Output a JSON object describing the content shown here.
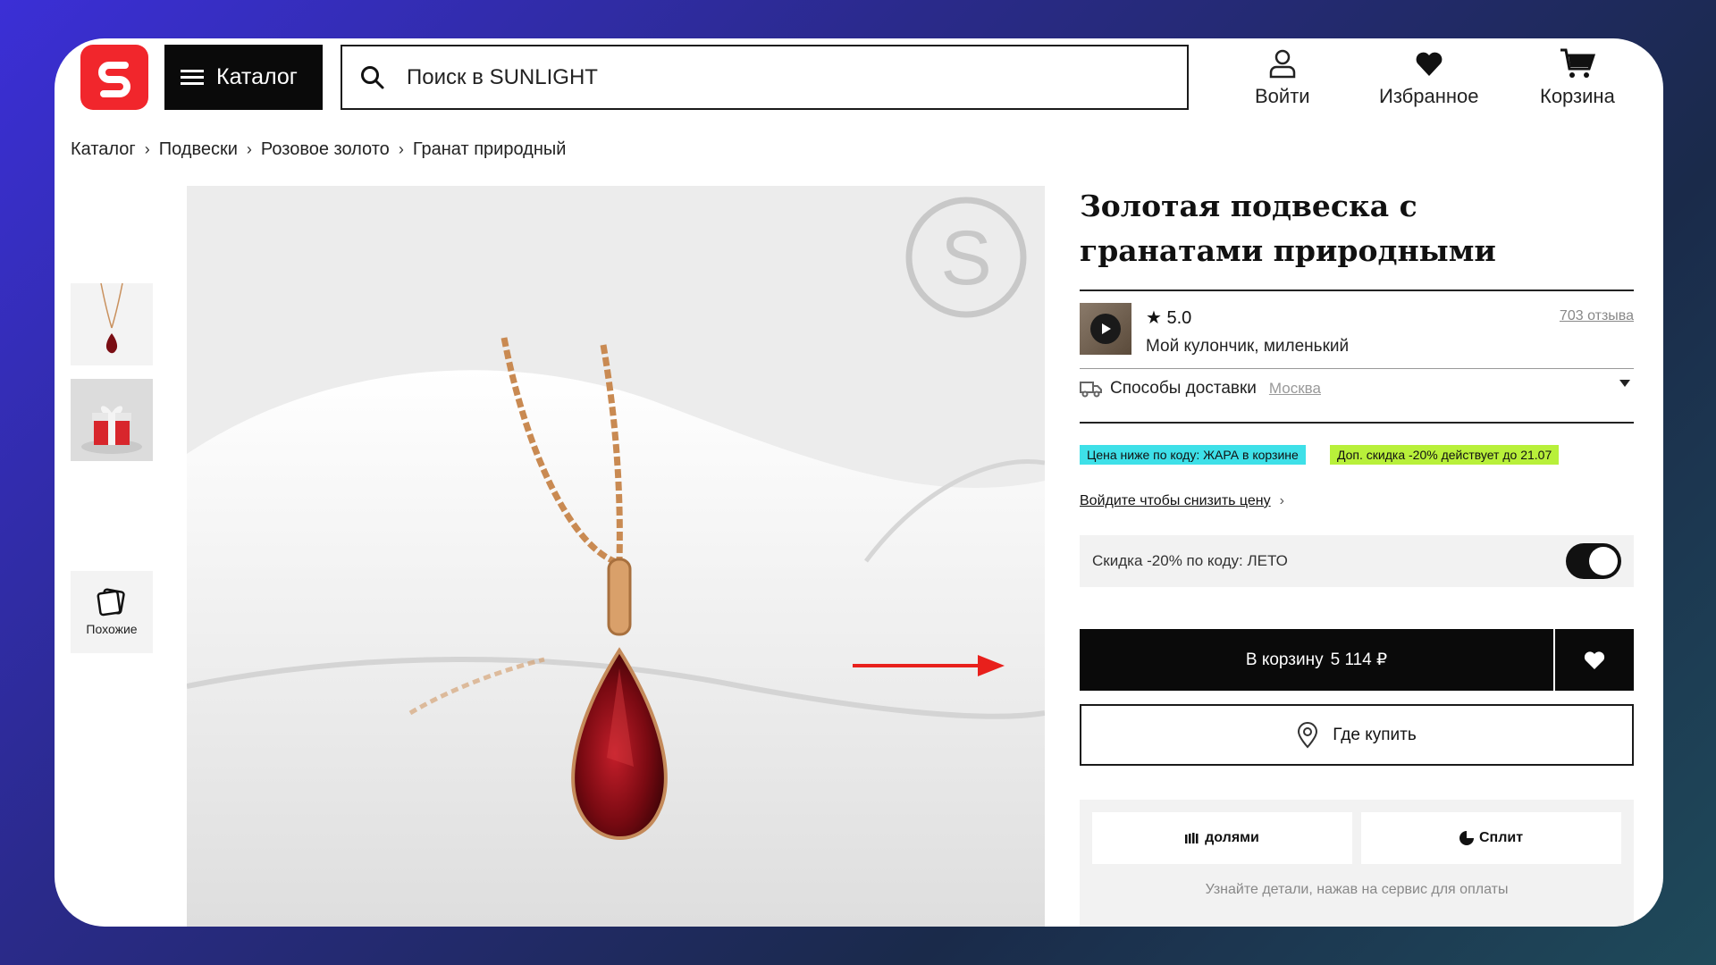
{
  "header": {
    "catalog_label": "Каталог",
    "search_placeholder": "Поиск в SUNLIGHT",
    "login_label": "Войти",
    "favorites_label": "Избранное",
    "cart_label": "Корзина"
  },
  "breadcrumbs": [
    "Каталог",
    "Подвески",
    "Розовое золото",
    "Гранат природный"
  ],
  "gallery": {
    "similar_label": "Похожие",
    "watermark_letter": "S"
  },
  "product": {
    "title": "Золотая подвеска с гранатами природными",
    "rating": "5.0",
    "reviews_count": "703 отзыва",
    "review_text": "Мой кулончик, миленький",
    "delivery_label": "Способы доставки",
    "delivery_city": "Москва",
    "promo_1": "Цена ниже по коду: ЖАРА в корзине",
    "promo_2": "Доп. скидка -20% действует до 21.07",
    "login_discount_link": "Войдите чтобы снизить цену",
    "discount_code_label": "Скидка -20% по коду: ЛЕТО",
    "discount_enabled": true,
    "cart_button_label": "В корзину",
    "price": "5 114 ₽",
    "where_to_buy_label": "Где купить",
    "payment_option_1": "долями",
    "payment_option_2": "Сплит",
    "payment_note": "Узнайте детали, нажав на сервис для оплаты"
  },
  "colors": {
    "brand_red": "#f1262c",
    "promo_cyan": "#3ee0e8",
    "promo_green": "#b8f03a",
    "annotation_arrow": "#e8201c"
  }
}
